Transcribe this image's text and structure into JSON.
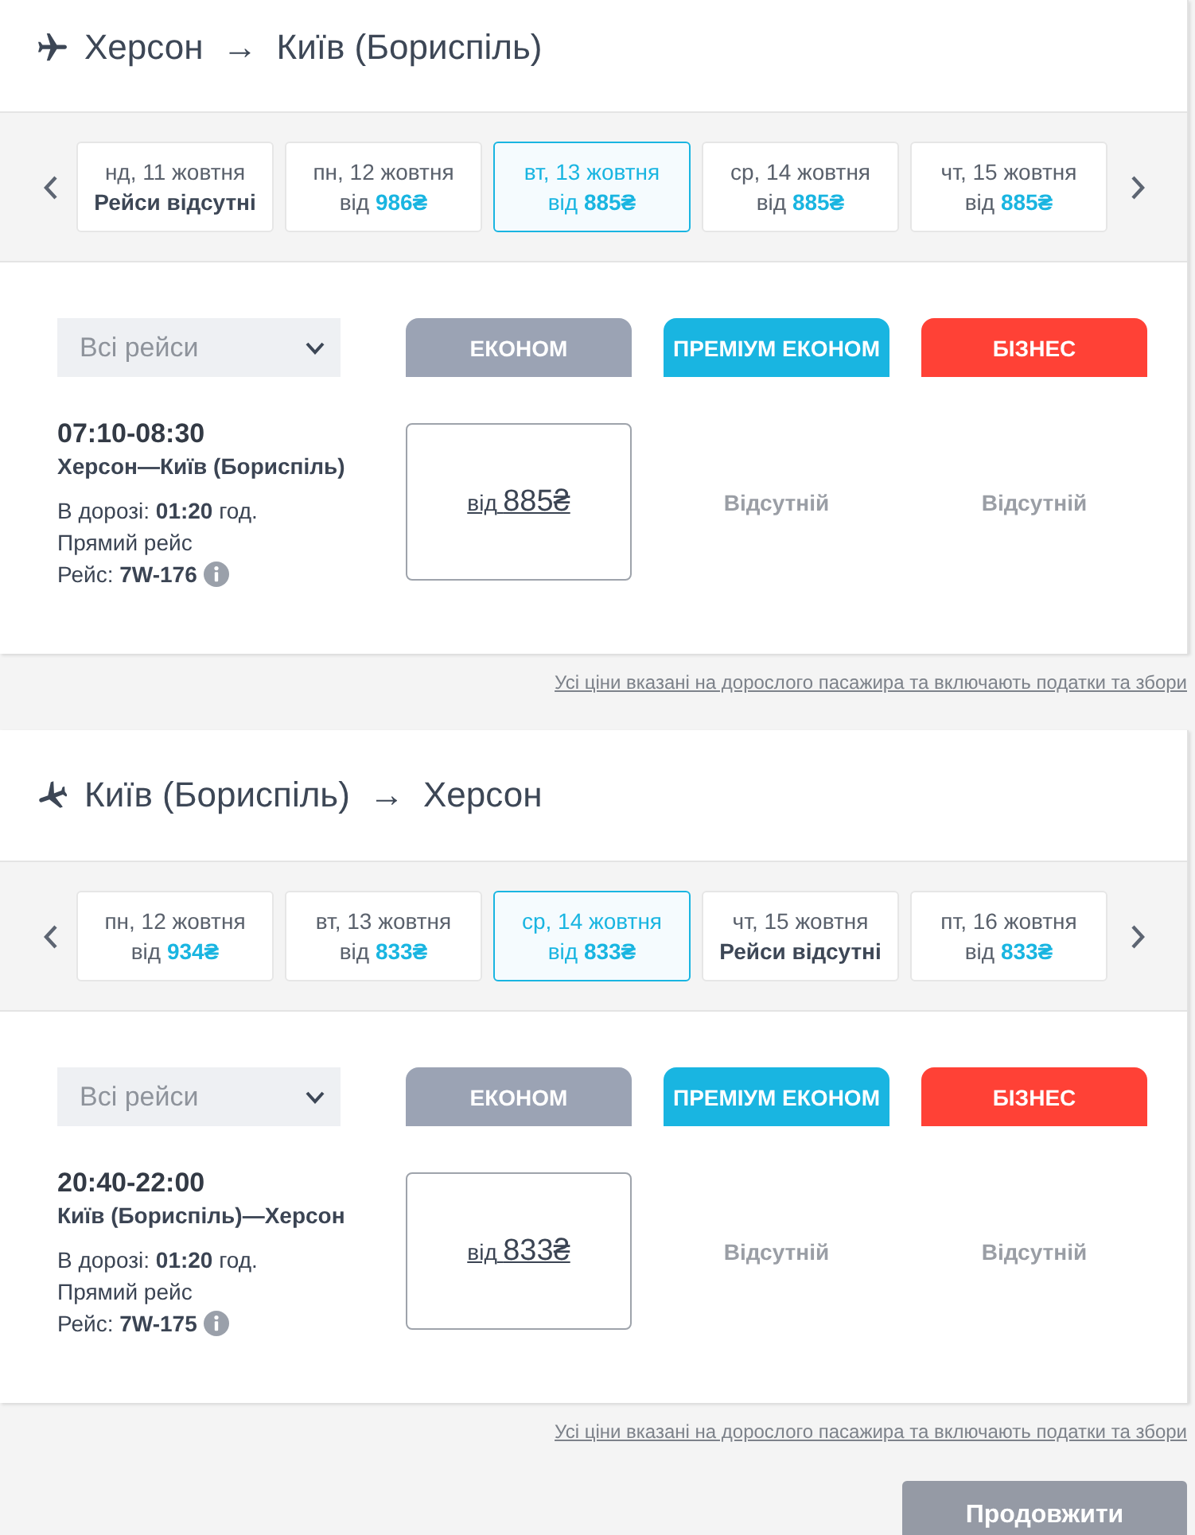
{
  "routes": [
    {
      "kind": "outbound",
      "from": "Херсон",
      "arrow": "→",
      "to": "Київ (Бориспіль)",
      "dates": [
        {
          "label": "нд, 11 жовтня",
          "kind": "none",
          "note": "Рейси відсутні",
          "selected": false
        },
        {
          "label": "пн, 12 жовтня",
          "kind": "price",
          "prefix": "від",
          "price": "986₴",
          "selected": false
        },
        {
          "label": "вт, 13 жовтня",
          "kind": "price",
          "prefix": "від",
          "price": "885₴",
          "selected": true
        },
        {
          "label": "ср, 14 жовтня",
          "kind": "price",
          "prefix": "від",
          "price": "885₴",
          "selected": false
        },
        {
          "label": "чт, 15 жовтня",
          "kind": "price",
          "prefix": "від",
          "price": "885₴",
          "selected": false
        }
      ],
      "filter": {
        "value": "Всі рейси"
      },
      "classes": [
        {
          "label": "ЕКОНОМ",
          "color": "#9ba3b4"
        },
        {
          "label": "ПРЕМІУМ ЕКОНОМ",
          "color": "#19b5e1"
        },
        {
          "label": "БІЗНЕС",
          "color": "#ff4136"
        }
      ],
      "flights": [
        {
          "time": "07:10-08:30",
          "route": "Херсон—Київ (Бориспіль)",
          "duration": "В дорозі: **01:20** год.",
          "type": "Прямий рейс",
          "number": "Рейс: **7W-176**",
          "fares": [
            {
              "kind": "price",
              "prefix": "від",
              "price": "885₴"
            },
            {
              "kind": "none",
              "text": "Відсутній"
            },
            {
              "kind": "none",
              "text": "Відсутній"
            }
          ]
        }
      ],
      "disclaimer": "Усі ціни вказані на дорослого пасажира та включають податки та збори"
    },
    {
      "kind": "return",
      "from": "Київ (Бориспіль)",
      "arrow": "→",
      "to": "Херсон",
      "dates": [
        {
          "label": "пн, 12 жовтня",
          "kind": "price",
          "prefix": "від",
          "price": "934₴",
          "selected": false
        },
        {
          "label": "вт, 13 жовтня",
          "kind": "price",
          "prefix": "від",
          "price": "833₴",
          "selected": false
        },
        {
          "label": "ср, 14 жовтня",
          "kind": "price",
          "prefix": "від",
          "price": "833₴",
          "selected": true
        },
        {
          "label": "чт, 15 жовтня",
          "kind": "none",
          "note": "Рейси відсутні",
          "selected": false
        },
        {
          "label": "пт, 16 жовтня",
          "kind": "price",
          "prefix": "від",
          "price": "833₴",
          "selected": false
        }
      ],
      "filter": {
        "value": "Всі рейси"
      },
      "classes": [
        {
          "label": "ЕКОНОМ",
          "color": "#9ba3b4"
        },
        {
          "label": "ПРЕМІУМ ЕКОНОМ",
          "color": "#19b5e1"
        },
        {
          "label": "БІЗНЕС",
          "color": "#ff4136"
        }
      ],
      "flights": [
        {
          "time": "20:40-22:00",
          "route": "Київ (Бориспіль)—Херсон",
          "duration": "В дорозі: **01:20** год.",
          "type": "Прямий рейс",
          "number": "Рейс: **7W-175**",
          "fares": [
            {
              "kind": "price",
              "prefix": "від",
              "price": "833₴"
            },
            {
              "kind": "none",
              "text": "Відсутній"
            },
            {
              "kind": "none",
              "text": "Відсутній"
            }
          ]
        }
      ],
      "disclaimer": "Усі ціни вказані на дорослого пасажира та включають податки та збори"
    }
  ],
  "continue_button": "Продовжити"
}
